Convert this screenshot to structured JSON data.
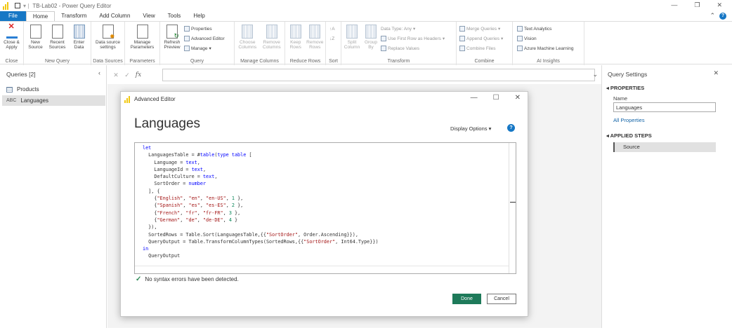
{
  "window": {
    "title": "TB-Lab02 - Power Query Editor"
  },
  "tabs": [
    "File",
    "Home",
    "Transform",
    "Add Column",
    "View",
    "Tools",
    "Help"
  ],
  "ribbon": {
    "close": {
      "btn": [
        "Close &",
        "Apply"
      ],
      "label": "Close"
    },
    "new_query": {
      "btns": [
        [
          "New",
          "Source"
        ],
        [
          "Recent",
          "Sources"
        ],
        [
          "Enter",
          "Data"
        ]
      ],
      "label": "New Query"
    },
    "data_sources": {
      "btn": [
        "Data source",
        "settings"
      ],
      "label": "Data Sources"
    },
    "parameters": {
      "btn": [
        "Manage",
        "Parameters"
      ],
      "label": "Parameters"
    },
    "query": {
      "btn": [
        "Refresh",
        "Preview"
      ],
      "small": [
        "Properties",
        "Advanced Editor",
        "Manage"
      ],
      "label": "Query"
    },
    "manage_columns": {
      "btns": [
        [
          "Choose",
          "Columns"
        ],
        [
          "Remove",
          "Columns"
        ]
      ],
      "label": "Manage Columns"
    },
    "reduce_rows": {
      "btns": [
        [
          "Keep",
          "Rows"
        ],
        [
          "Remove",
          "Rows"
        ]
      ],
      "label": "Reduce Rows"
    },
    "sort": {
      "label": "Sort"
    },
    "transform": {
      "btns": [
        [
          "Split",
          "Column"
        ],
        [
          "Group",
          "By"
        ]
      ],
      "small": [
        "Data Type: Any",
        "Use First Row as Headers",
        "Replace Values"
      ],
      "label": "Transform"
    },
    "combine": {
      "small": [
        "Merge Queries",
        "Append Queries",
        "Combine Files"
      ],
      "label": "Combine"
    },
    "ai": {
      "small": [
        "Text Analytics",
        "Vision",
        "Azure Machine Learning"
      ],
      "label": "AI Insights"
    }
  },
  "queries": {
    "header": "Queries [2]",
    "items": [
      "Products",
      "Languages"
    ]
  },
  "formula": {
    "fx": "fx"
  },
  "settings": {
    "title": "Query Settings",
    "properties": "PROPERTIES",
    "name_label": "Name",
    "name_value": "Languages",
    "all_props": "All Properties",
    "applied": "APPLIED STEPS",
    "steps": [
      "Source"
    ]
  },
  "dialog": {
    "title": "Advanced Editor",
    "heading": "Languages",
    "display_options": "Display Options",
    "syntax": "No syntax errors have been detected.",
    "done": "Done",
    "cancel": "Cancel",
    "code": [
      "let",
      "  LanguagesTable = #table(type table [",
      "    Language = text,",
      "    LanguageId = text,",
      "    DefaultCulture = text,",
      "    SortOrder = number",
      "  ], {",
      "    {\"English\", \"en\", \"en-US\", 1 },",
      "    {\"Spanish\", \"es\", \"es-ES\", 2 },",
      "    {\"French\", \"fr\", \"fr-FR\", 3 },",
      "    {\"German\", \"de\", \"de-DE\", 4 }",
      "  }),",
      "  SortedRows = Table.Sort(LanguagesTable,{{\"SortOrder\", Order.Ascending}}),",
      "  QueryOutput = Table.TransformColumnTypes(SortedRows,{{\"SortOrder\", Int64.Type}})",
      "in",
      "  QueryOutput"
    ]
  }
}
